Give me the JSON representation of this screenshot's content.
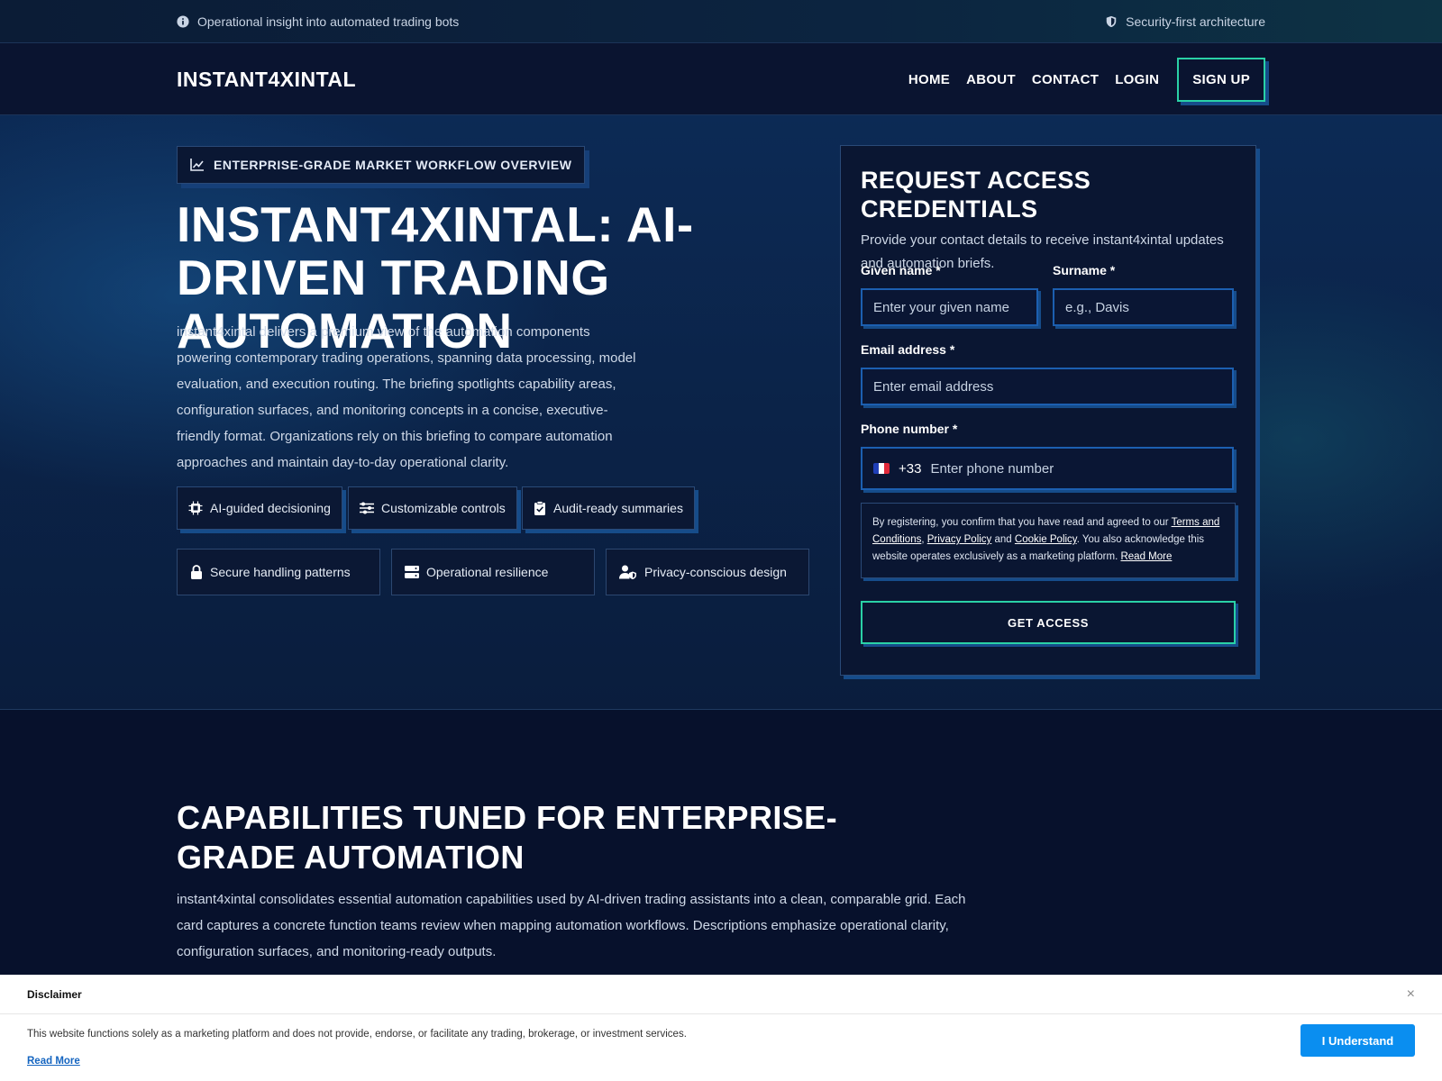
{
  "topbar": {
    "left_text": "Operational insight into automated trading bots",
    "left_icon": "info-icon",
    "right_text": "Security-first architecture",
    "right_icon": "shield-icon"
  },
  "nav": {
    "brand": "INSTANT4XINTAL",
    "links": [
      "HOME",
      "ABOUT",
      "CONTACT",
      "LOGIN"
    ],
    "signup": "SIGN UP"
  },
  "hero": {
    "badge": "ENTERPRISE-GRADE MARKET WORKFLOW OVERVIEW",
    "title": "INSTANT4XINTAL: AI-DRIVEN TRADING AUTOMATION",
    "lead": "instant4xintal delivers a premium view of the automation components powering contemporary trading operations, spanning data processing, model evaluation, and execution routing. The briefing spotlights capability areas, configuration surfaces, and monitoring concepts in a concise, executive-friendly format. Organizations rely on this briefing to compare automation approaches and maintain day-to-day operational clarity.",
    "chips": [
      {
        "label": "AI-guided decisioning",
        "icon": "chip-icon"
      },
      {
        "label": "Customizable controls",
        "icon": "sliders-icon"
      },
      {
        "label": "Audit-ready summaries",
        "icon": "clipboard-check-icon"
      },
      {
        "label": "Secure handling patterns",
        "icon": "lock-icon"
      },
      {
        "label": "Operational resilience",
        "icon": "server-icon"
      },
      {
        "label": "Privacy-conscious design",
        "icon": "user-shield-icon"
      }
    ]
  },
  "form": {
    "title": "REQUEST ACCESS CREDENTIALS",
    "subtitle": "Provide your contact details to receive instant4xintal updates and automation briefs.",
    "given_label": "Given name *",
    "given_placeholder": "Enter your given name",
    "surname_label": "Surname *",
    "surname_placeholder": "e.g., Davis",
    "email_label": "Email address *",
    "email_placeholder": "Enter email address",
    "phone_label": "Phone number *",
    "phone_code": "+33",
    "phone_placeholder": "Enter phone number",
    "consent_prefix": "By registering, you confirm that you have read and agreed to our ",
    "terms": "Terms and Conditions",
    "comma": ", ",
    "privacy": "Privacy Policy",
    "and": " and ",
    "cookie": "Cookie Policy",
    "consent_suffix": ". You also acknowledge this website operates exclusively as a marketing platform. ",
    "read_more": "Read More",
    "submit": "GET ACCESS"
  },
  "capabilities": {
    "title": "CAPABILITIES TUNED FOR ENTERPRISE-GRADE AUTOMATION",
    "text": "instant4xintal consolidates essential automation capabilities used by AI-driven trading assistants into a clean, comparable grid. Each card captures a concrete function teams review when mapping automation workflows. Descriptions emphasize operational clarity, configuration surfaces, and monitoring-ready outputs."
  },
  "disclaimer": {
    "title": "Disclaimer",
    "text": "This website functions solely as a marketing platform and does not provide, endorse, or facilitate any trading, brokerage, or investment services.",
    "link": "Read More",
    "button": "I Understand",
    "close": "×"
  },
  "colors": {
    "accent": "#2ad1a6",
    "shadow_blue": "#164c8a",
    "page_bg": "#08122e",
    "cta_blue": "#0a8ef0"
  }
}
